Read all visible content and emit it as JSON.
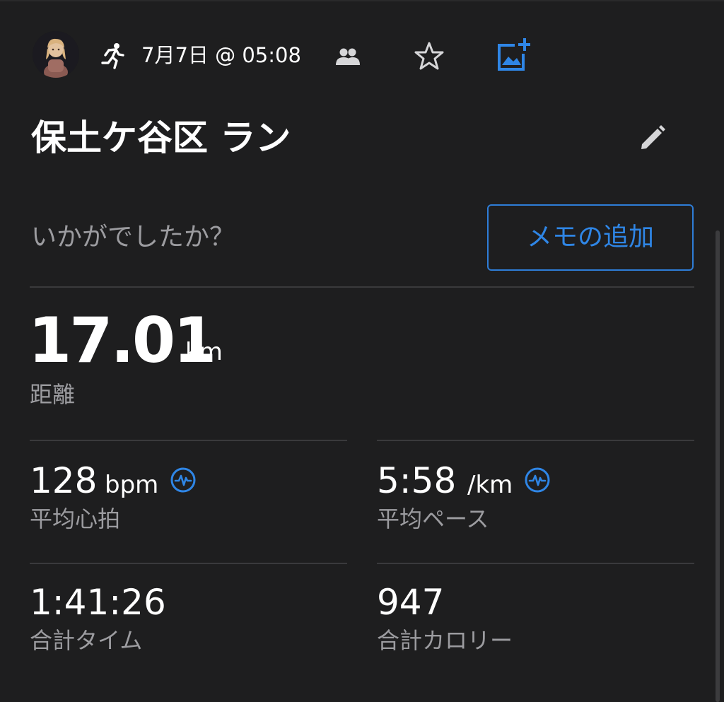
{
  "header": {
    "avatar_icon": "user-avatar",
    "activity_icon": "running-icon",
    "date_time": "7月7日 @ 05:08",
    "people_icon": "people-icon",
    "star_icon": "star-outline-icon",
    "photo_icon": "add-photo-icon"
  },
  "activity": {
    "title": "保土ケ谷区 ラン",
    "edit_icon": "pencil-icon"
  },
  "notes": {
    "prompt": "いかがでしたか？",
    "add_memo_label": "メモの追加"
  },
  "distance": {
    "value": "17.01",
    "unit": "km",
    "label": "距離"
  },
  "stats": {
    "heart_rate": {
      "value": "128",
      "unit": "bpm",
      "label": "平均心拍",
      "icon": "heart-rate-chart-icon"
    },
    "pace": {
      "value": "5:58",
      "unit": "/km",
      "label": "平均ペース",
      "icon": "pace-chart-icon"
    },
    "time": {
      "value": "1:41:26",
      "label": "合計タイム"
    },
    "calories": {
      "value": "947",
      "label": "合計カロリー"
    }
  },
  "colors": {
    "background": "#1e1e1f",
    "accent": "#2f86e6",
    "secondary_text": "#9c9ca0",
    "divider": "#3a3a3c"
  }
}
